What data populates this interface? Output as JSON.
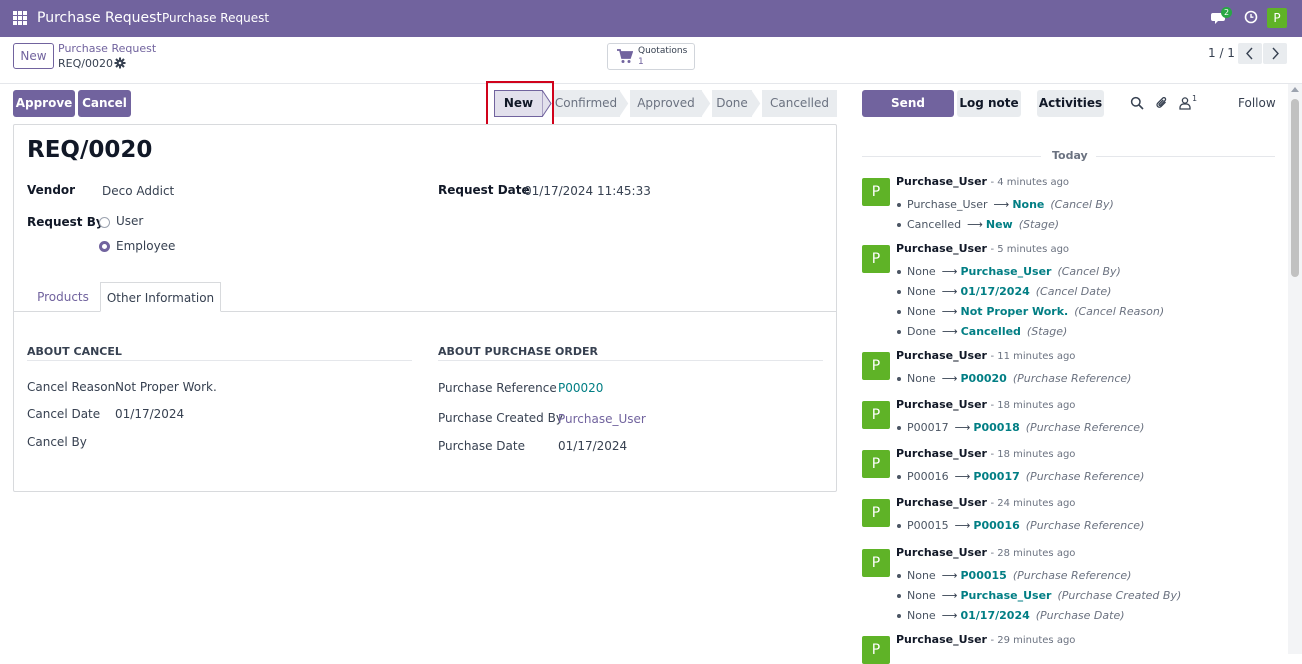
{
  "navbar": {
    "app_name": "Purchase Request",
    "menu_item": "Purchase Request",
    "chat_badge": "2",
    "avatar_initial": "P"
  },
  "control_panel": {
    "new_button": "New",
    "breadcrumb_parent": "Purchase Request",
    "breadcrumb_current": "REQ/0020",
    "smart_button": {
      "label": "Quotations",
      "value": "1"
    },
    "pager": "1 / 1"
  },
  "actions": {
    "approve": "Approve",
    "cancel": "Cancel"
  },
  "statusbar": {
    "stages": [
      "New",
      "Confirmed",
      "Approved",
      "Done",
      "Cancelled"
    ],
    "active": "New"
  },
  "form": {
    "title": "REQ/0020",
    "vendor_label": "Vendor",
    "vendor_value": "Deco Addict",
    "request_date_label": "Request Date",
    "request_date_value": "01/17/2024 11:45:33",
    "request_by_label": "Request By",
    "request_by_options": [
      "User",
      "Employee"
    ],
    "request_by_selected": "Employee",
    "tabs": [
      "Products",
      "Other Information"
    ],
    "active_tab": "Other Information",
    "about_cancel": {
      "title": "ABOUT CANCEL",
      "cancel_reason_label": "Cancel Reason",
      "cancel_reason_value": "Not Proper Work.",
      "cancel_date_label": "Cancel Date",
      "cancel_date_value": "01/17/2024",
      "cancel_by_label": "Cancel By",
      "cancel_by_value": ""
    },
    "about_purchase_order": {
      "title": "ABOUT PURCHASE ORDER",
      "purchase_reference_label": "Purchase Reference",
      "purchase_reference_value": "P00020",
      "purchase_created_by_label": "Purchase Created By",
      "purchase_created_by_value": "Purchase_User",
      "purchase_date_label": "Purchase Date",
      "purchase_date_value": "01/17/2024"
    }
  },
  "chatter": {
    "send_message": "Send message",
    "log_note": "Log note",
    "activities": "Activities",
    "follower_count": "1",
    "follow": "Follow",
    "today": "Today",
    "messages": [
      {
        "avatar": "P",
        "author": "Purchase_User",
        "date": "- 4 minutes ago",
        "changes": [
          {
            "old": "Purchase_User",
            "new": "None",
            "field": "(Cancel By)"
          },
          {
            "old": "Cancelled",
            "new": "New",
            "field": "(Stage)"
          }
        ]
      },
      {
        "avatar": "P",
        "author": "Purchase_User",
        "date": "- 5 minutes ago",
        "changes": [
          {
            "old": "None",
            "new": "Purchase_User",
            "field": "(Cancel By)"
          },
          {
            "old": "None",
            "new": "01/17/2024",
            "field": "(Cancel Date)"
          },
          {
            "old": "None",
            "new": "Not Proper Work.",
            "field": "(Cancel Reason)"
          },
          {
            "old": "Done",
            "new": "Cancelled",
            "field": "(Stage)"
          }
        ]
      },
      {
        "avatar": "P",
        "author": "Purchase_User",
        "date": "- 11 minutes ago",
        "changes": [
          {
            "old": "None",
            "new": "P00020",
            "field": "(Purchase Reference)"
          }
        ]
      },
      {
        "avatar": "P",
        "author": "Purchase_User",
        "date": "- 18 minutes ago",
        "changes": [
          {
            "old": "P00017",
            "new": "P00018",
            "field": "(Purchase Reference)"
          }
        ]
      },
      {
        "avatar": "P",
        "author": "Purchase_User",
        "date": "- 18 minutes ago",
        "changes": [
          {
            "old": "P00016",
            "new": "P00017",
            "field": "(Purchase Reference)"
          }
        ]
      },
      {
        "avatar": "P",
        "author": "Purchase_User",
        "date": "- 24 minutes ago",
        "changes": [
          {
            "old": "P00015",
            "new": "P00016",
            "field": "(Purchase Reference)"
          }
        ]
      },
      {
        "avatar": "P",
        "author": "Purchase_User",
        "date": "- 28 minutes ago",
        "changes": [
          {
            "old": "None",
            "new": "P00015",
            "field": "(Purchase Reference)"
          },
          {
            "old": "None",
            "new": "Purchase_User",
            "field": "(Purchase Created By)"
          },
          {
            "old": "None",
            "new": "01/17/2024",
            "field": "(Purchase Date)"
          }
        ]
      },
      {
        "avatar": "P",
        "author": "Purchase_User",
        "date": "- 29 minutes ago",
        "changes": []
      }
    ]
  }
}
